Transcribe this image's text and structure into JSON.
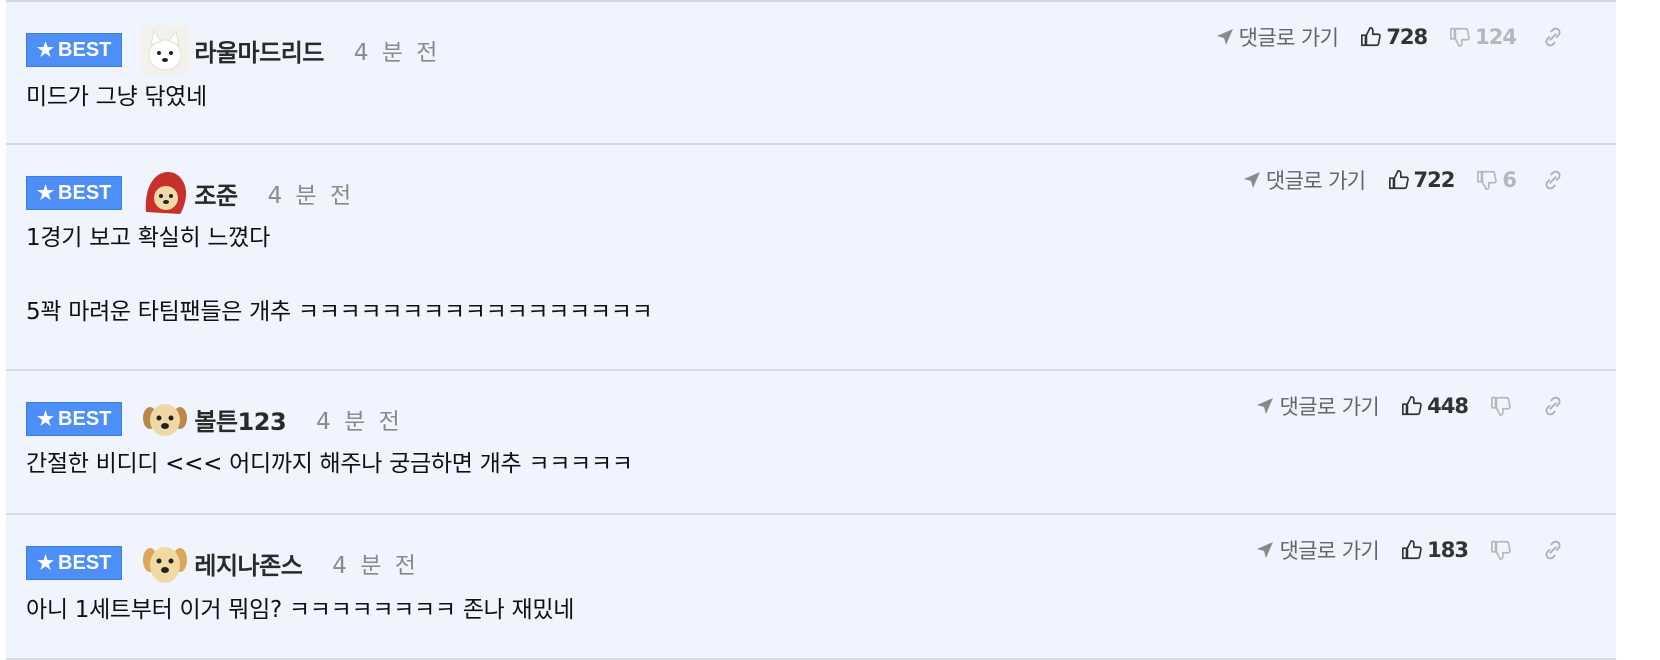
{
  "comments": [
    {
      "badge": "BEST",
      "nickname": "라울마드리드",
      "time": "4 분 전",
      "reply_label": "댓글로 가기",
      "upvotes": "728",
      "downvotes": "124",
      "body": [
        "미드가 그냥 닦였네"
      ],
      "avatar": "white-dog"
    },
    {
      "badge": "BEST",
      "nickname": "조준",
      "time": "4 분 전",
      "reply_label": "댓글로 가기",
      "upvotes": "722",
      "downvotes": "6",
      "body": [
        "1경기 보고 확실히 느꼈다",
        "5꽉 마려운 타팀팬들은 개추 ㅋㅋㅋㅋㅋㅋㅋㅋㅋㅋㅋㅋㅋㅋㅋㅋㅋ"
      ],
      "avatar": "hooded-dog"
    },
    {
      "badge": "BEST",
      "nickname": "볼튼123",
      "time": "4 분 전",
      "reply_label": "댓글로 가기",
      "upvotes": "448",
      "downvotes": "",
      "body": [
        "간절한 비디디 <<< 어디까지 해주나 궁금하면 개추 ㅋㅋㅋㅋㅋ"
      ],
      "avatar": "puppy"
    },
    {
      "badge": "BEST",
      "nickname": "레지나존스",
      "time": "4 분 전",
      "reply_label": "댓글로 가기",
      "upvotes": "183",
      "downvotes": "",
      "body": [
        "아니 1세트부터 이거 뭐임? ㅋㅋㅋㅋㅋㅋㅋㅋ 존나 재밌네"
      ],
      "avatar": "golden-puppy"
    }
  ],
  "colors": {
    "best_badge": "#4d8ff7",
    "row_background": "#eff4fe",
    "divider": "#d6d9de"
  }
}
